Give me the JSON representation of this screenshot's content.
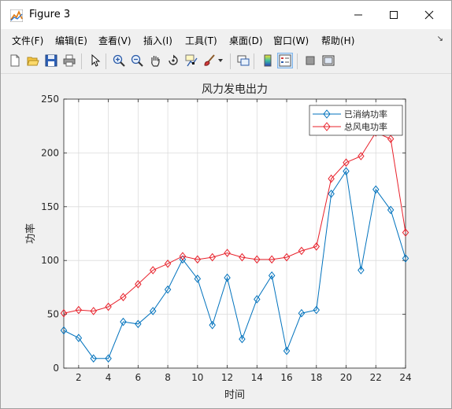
{
  "window": {
    "title": "Figure 3"
  },
  "menu": {
    "items": [
      "文件(F)",
      "编辑(E)",
      "查看(V)",
      "插入(I)",
      "工具(T)",
      "桌面(D)",
      "窗口(W)",
      "帮助(H)"
    ]
  },
  "toolbar": {
    "icons": [
      "new-figure-icon",
      "open-file-icon",
      "save-icon",
      "print-icon",
      "pointer-icon",
      "zoom-in-icon",
      "zoom-out-icon",
      "pan-hand-icon",
      "rotate-3d-icon",
      "data-cursor-icon",
      "brush-icon",
      "link-plot-icon",
      "colorbar-icon",
      "legend-icon",
      "hide-plot-tools-icon",
      "show-plot-tools-icon"
    ]
  },
  "chart_data": {
    "type": "line",
    "title": "风力发电出力",
    "xlabel": "时间",
    "ylabel": "功率",
    "xlim": [
      1,
      24
    ],
    "ylim": [
      0,
      250
    ],
    "x_ticks": [
      2,
      4,
      6,
      8,
      10,
      12,
      14,
      16,
      18,
      20,
      22,
      24
    ],
    "y_ticks": [
      0,
      50,
      100,
      150,
      200,
      250
    ],
    "grid": true,
    "legend_position": "top-right",
    "x": [
      1,
      2,
      3,
      4,
      5,
      6,
      7,
      8,
      9,
      10,
      11,
      12,
      13,
      14,
      15,
      16,
      17,
      18,
      19,
      20,
      21,
      22,
      23,
      24
    ],
    "series": [
      {
        "name": "已消纳功率",
        "color": "#0072bd",
        "marker": "diamond",
        "values": [
          35,
          28,
          9,
          9,
          43,
          41,
          53,
          73,
          101,
          83,
          40,
          84,
          27,
          64,
          86,
          16,
          51,
          54,
          162,
          183,
          91,
          166,
          147,
          102
        ]
      },
      {
        "name": "总风电功率",
        "color": "#e8202a",
        "marker": "diamond",
        "values": [
          51,
          54,
          53,
          57,
          66,
          78,
          91,
          97,
          104,
          101,
          103,
          107,
          103,
          101,
          101,
          103,
          109,
          113,
          176,
          191,
          197,
          219,
          213,
          126
        ]
      }
    ]
  }
}
